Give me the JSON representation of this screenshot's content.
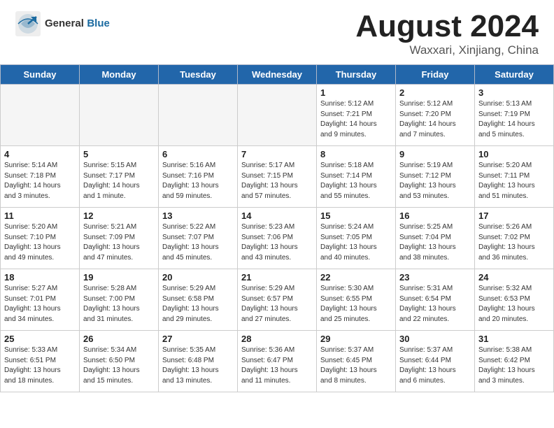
{
  "header": {
    "logo_general": "General",
    "logo_blue": "Blue",
    "main_title": "August 2024",
    "sub_title": "Waxxari, Xinjiang, China"
  },
  "calendar": {
    "days_of_week": [
      "Sunday",
      "Monday",
      "Tuesday",
      "Wednesday",
      "Thursday",
      "Friday",
      "Saturday"
    ],
    "weeks": [
      [
        {
          "day": "",
          "info": "",
          "empty": true
        },
        {
          "day": "",
          "info": "",
          "empty": true
        },
        {
          "day": "",
          "info": "",
          "empty": true
        },
        {
          "day": "",
          "info": "",
          "empty": true
        },
        {
          "day": "1",
          "info": "Sunrise: 5:12 AM\nSunset: 7:21 PM\nDaylight: 14 hours\nand 9 minutes."
        },
        {
          "day": "2",
          "info": "Sunrise: 5:12 AM\nSunset: 7:20 PM\nDaylight: 14 hours\nand 7 minutes."
        },
        {
          "day": "3",
          "info": "Sunrise: 5:13 AM\nSunset: 7:19 PM\nDaylight: 14 hours\nand 5 minutes."
        }
      ],
      [
        {
          "day": "4",
          "info": "Sunrise: 5:14 AM\nSunset: 7:18 PM\nDaylight: 14 hours\nand 3 minutes."
        },
        {
          "day": "5",
          "info": "Sunrise: 5:15 AM\nSunset: 7:17 PM\nDaylight: 14 hours\nand 1 minute."
        },
        {
          "day": "6",
          "info": "Sunrise: 5:16 AM\nSunset: 7:16 PM\nDaylight: 13 hours\nand 59 minutes."
        },
        {
          "day": "7",
          "info": "Sunrise: 5:17 AM\nSunset: 7:15 PM\nDaylight: 13 hours\nand 57 minutes."
        },
        {
          "day": "8",
          "info": "Sunrise: 5:18 AM\nSunset: 7:14 PM\nDaylight: 13 hours\nand 55 minutes."
        },
        {
          "day": "9",
          "info": "Sunrise: 5:19 AM\nSunset: 7:12 PM\nDaylight: 13 hours\nand 53 minutes."
        },
        {
          "day": "10",
          "info": "Sunrise: 5:20 AM\nSunset: 7:11 PM\nDaylight: 13 hours\nand 51 minutes."
        }
      ],
      [
        {
          "day": "11",
          "info": "Sunrise: 5:20 AM\nSunset: 7:10 PM\nDaylight: 13 hours\nand 49 minutes."
        },
        {
          "day": "12",
          "info": "Sunrise: 5:21 AM\nSunset: 7:09 PM\nDaylight: 13 hours\nand 47 minutes."
        },
        {
          "day": "13",
          "info": "Sunrise: 5:22 AM\nSunset: 7:07 PM\nDaylight: 13 hours\nand 45 minutes."
        },
        {
          "day": "14",
          "info": "Sunrise: 5:23 AM\nSunset: 7:06 PM\nDaylight: 13 hours\nand 43 minutes."
        },
        {
          "day": "15",
          "info": "Sunrise: 5:24 AM\nSunset: 7:05 PM\nDaylight: 13 hours\nand 40 minutes."
        },
        {
          "day": "16",
          "info": "Sunrise: 5:25 AM\nSunset: 7:04 PM\nDaylight: 13 hours\nand 38 minutes."
        },
        {
          "day": "17",
          "info": "Sunrise: 5:26 AM\nSunset: 7:02 PM\nDaylight: 13 hours\nand 36 minutes."
        }
      ],
      [
        {
          "day": "18",
          "info": "Sunrise: 5:27 AM\nSunset: 7:01 PM\nDaylight: 13 hours\nand 34 minutes."
        },
        {
          "day": "19",
          "info": "Sunrise: 5:28 AM\nSunset: 7:00 PM\nDaylight: 13 hours\nand 31 minutes."
        },
        {
          "day": "20",
          "info": "Sunrise: 5:29 AM\nSunset: 6:58 PM\nDaylight: 13 hours\nand 29 minutes."
        },
        {
          "day": "21",
          "info": "Sunrise: 5:29 AM\nSunset: 6:57 PM\nDaylight: 13 hours\nand 27 minutes."
        },
        {
          "day": "22",
          "info": "Sunrise: 5:30 AM\nSunset: 6:55 PM\nDaylight: 13 hours\nand 25 minutes."
        },
        {
          "day": "23",
          "info": "Sunrise: 5:31 AM\nSunset: 6:54 PM\nDaylight: 13 hours\nand 22 minutes."
        },
        {
          "day": "24",
          "info": "Sunrise: 5:32 AM\nSunset: 6:53 PM\nDaylight: 13 hours\nand 20 minutes."
        }
      ],
      [
        {
          "day": "25",
          "info": "Sunrise: 5:33 AM\nSunset: 6:51 PM\nDaylight: 13 hours\nand 18 minutes."
        },
        {
          "day": "26",
          "info": "Sunrise: 5:34 AM\nSunset: 6:50 PM\nDaylight: 13 hours\nand 15 minutes."
        },
        {
          "day": "27",
          "info": "Sunrise: 5:35 AM\nSunset: 6:48 PM\nDaylight: 13 hours\nand 13 minutes."
        },
        {
          "day": "28",
          "info": "Sunrise: 5:36 AM\nSunset: 6:47 PM\nDaylight: 13 hours\nand 11 minutes."
        },
        {
          "day": "29",
          "info": "Sunrise: 5:37 AM\nSunset: 6:45 PM\nDaylight: 13 hours\nand 8 minutes."
        },
        {
          "day": "30",
          "info": "Sunrise: 5:37 AM\nSunset: 6:44 PM\nDaylight: 13 hours\nand 6 minutes."
        },
        {
          "day": "31",
          "info": "Sunrise: 5:38 AM\nSunset: 6:42 PM\nDaylight: 13 hours\nand 3 minutes."
        }
      ]
    ]
  }
}
